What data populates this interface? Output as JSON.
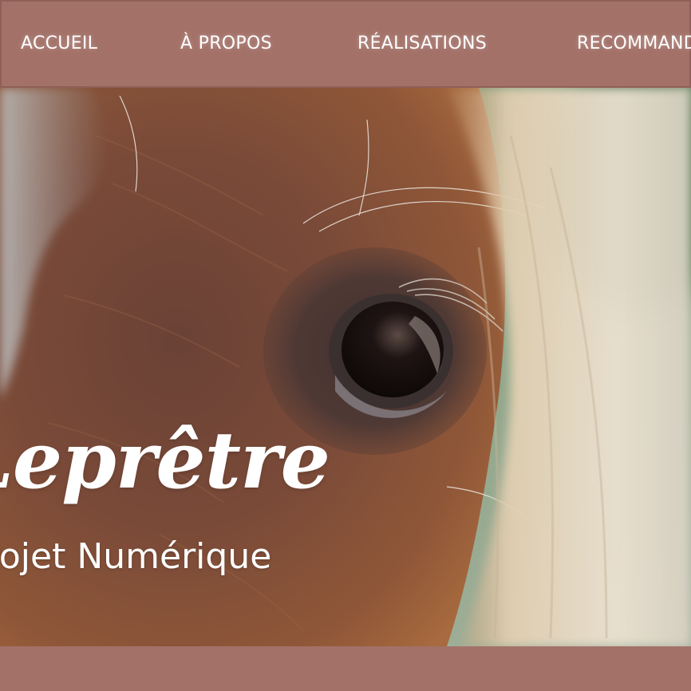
{
  "nav": {
    "items": [
      {
        "label": "ACCUEIL"
      },
      {
        "label": "À PROPOS"
      },
      {
        "label": "RÉALISATIONS"
      },
      {
        "label": "RECOMMANDATIONS"
      }
    ]
  },
  "hero": {
    "title": "Leprêtre",
    "subtitle": "Projet Numérique",
    "image": "horse-eye-closeup-photo"
  },
  "colors": {
    "nav_background": "#a37168",
    "footer_strip": "#a37168",
    "text": "#ffffff"
  }
}
